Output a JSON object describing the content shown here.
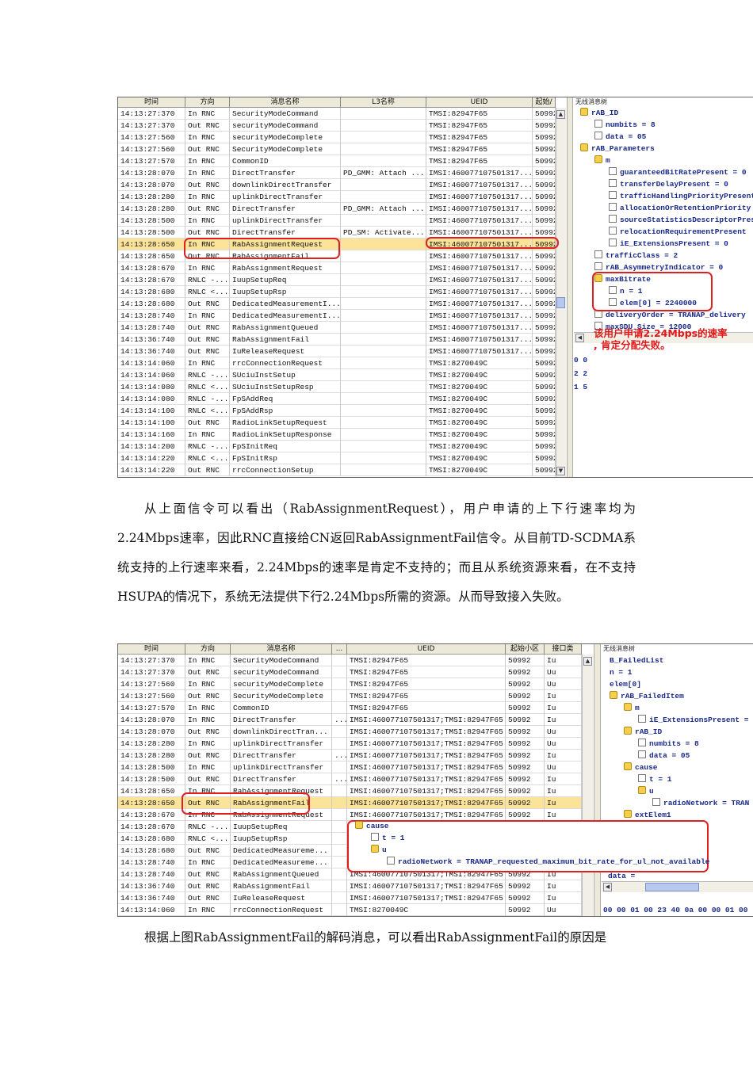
{
  "shot1": {
    "headers": [
      "时间",
      "方向",
      "消息名称",
      "L3名称",
      "UEID",
      "起始/"
    ],
    "rows": [
      [
        "14:13:27:370",
        "In RNC",
        "SecurityModeCommand",
        "",
        "TMSI:82947F65",
        "50992"
      ],
      [
        "14:13:27:370",
        "Out RNC",
        "securityModeCommand",
        "",
        "TMSI:82947F65",
        "50992"
      ],
      [
        "14:13:27:560",
        "In RNC",
        "securityModeComplete",
        "",
        "TMSI:82947F65",
        "50992"
      ],
      [
        "14:13:27:560",
        "Out RNC",
        "SecurityModeComplete",
        "",
        "TMSI:82947F65",
        "50992"
      ],
      [
        "14:13:27:570",
        "In RNC",
        "CommonID",
        "",
        "TMSI:82947F65",
        "50992"
      ],
      [
        "14:13:28:070",
        "In RNC",
        "DirectTransfer",
        "PD_GMM: Attach ...",
        "IMSI:460077107501317...",
        "50992"
      ],
      [
        "14:13:28:070",
        "Out RNC",
        "downlinkDirectTransfer",
        "",
        "IMSI:460077107501317...",
        "50992"
      ],
      [
        "14:13:28:280",
        "In RNC",
        "uplinkDirectTransfer",
        "",
        "IMSI:460077107501317...",
        "50992"
      ],
      [
        "14:13:28:280",
        "Out RNC",
        "DirectTransfer",
        "PD_GMM: Attach ...",
        "IMSI:460077107501317...",
        "50992"
      ],
      [
        "14:13:28:500",
        "In RNC",
        "uplinkDirectTransfer",
        "",
        "IMSI:460077107501317...",
        "50992"
      ],
      [
        "14:13:28:500",
        "Out RNC",
        "DirectTransfer",
        "PD_SM: Activate...",
        "IMSI:460077107501317...",
        "50992"
      ],
      [
        "14:13:28:650",
        "In RNC",
        "RabAssignmentRequest",
        "",
        "IMSI:460077107501317...",
        "50992"
      ],
      [
        "14:13:28:650",
        "Out RNC",
        "RabAssignmentFail",
        "",
        "IMSI:460077107501317...",
        "50992"
      ],
      [
        "14:13:28:670",
        "In RNC",
        "RabAssignmentRequest",
        "",
        "IMSI:460077107501317...",
        "50992"
      ],
      [
        "14:13:28:670",
        "RNLC -...",
        "IuupSetupReq",
        "",
        "IMSI:460077107501317...",
        "50992"
      ],
      [
        "14:13:28:680",
        "RNLC <...",
        "IuupSetupRsp",
        "",
        "IMSI:460077107501317...",
        "50992"
      ],
      [
        "14:13:28:680",
        "Out RNC",
        "DedicatedMeasurementI...",
        "",
        "IMSI:460077107501317...",
        "50992"
      ],
      [
        "14:13:28:740",
        "In RNC",
        "DedicatedMeasurementI...",
        "",
        "IMSI:460077107501317...",
        "50992"
      ],
      [
        "14:13:28:740",
        "Out RNC",
        "RabAssignmentQueued",
        "",
        "IMSI:460077107501317...",
        "50992"
      ],
      [
        "14:13:36:740",
        "Out RNC",
        "RabAssignmentFail",
        "",
        "IMSI:460077107501317...",
        "50992"
      ],
      [
        "14:13:36:740",
        "Out RNC",
        "IuReleaseRequest",
        "",
        "IMSI:460077107501317...",
        "50992"
      ],
      [
        "14:13:14:060",
        "In RNC",
        "rrcConnectionRequest",
        "",
        "TMSI:8270049C",
        "50992"
      ],
      [
        "14:13:14:060",
        "RNLC -...",
        "SUciuInstSetup",
        "",
        "TMSI:8270049C",
        "50992"
      ],
      [
        "14:13:14:080",
        "RNLC <...",
        "SUciuInstSetupResp",
        "",
        "TMSI:8270049C",
        "50992"
      ],
      [
        "14:13:14:080",
        "RNLC -...",
        "FpSAddReq",
        "",
        "TMSI:8270049C",
        "50992"
      ],
      [
        "14:13:14:100",
        "RNLC <...",
        "FpSAddRsp",
        "",
        "TMSI:8270049C",
        "50992"
      ],
      [
        "14:13:14:100",
        "Out RNC",
        "RadioLinkSetupRequest",
        "",
        "TMSI:8270049C",
        "50992"
      ],
      [
        "14:13:14:160",
        "In RNC",
        "RadioLinkSetupResponse",
        "",
        "TMSI:8270049C",
        "50992"
      ],
      [
        "14:13:14:200",
        "RNLC -...",
        "FpSInitReq",
        "",
        "TMSI:8270049C",
        "50992"
      ],
      [
        "14:13:14:220",
        "RNLC <...",
        "FpSInitRsp",
        "",
        "TMSI:8270049C",
        "50992"
      ],
      [
        "14:13:14:220",
        "Out RNC",
        "rrcConnectionSetup",
        "",
        "TMSI:8270049C",
        "50992"
      ]
    ],
    "selected_row": 11,
    "tree_title": "无线消息树",
    "tree": [
      [
        0,
        "folder",
        "rAB_ID"
      ],
      [
        1,
        "file",
        "numbits = 8"
      ],
      [
        1,
        "file",
        "data = 05"
      ],
      [
        0,
        "folder",
        "rAB_Parameters"
      ],
      [
        1,
        "folder",
        "m"
      ],
      [
        2,
        "file",
        "guaranteedBitRatePresent = 0"
      ],
      [
        2,
        "file",
        "transferDelayPresent = 0"
      ],
      [
        2,
        "file",
        "trafficHandlingPriorityPresent"
      ],
      [
        2,
        "file",
        "allocationOrRetentionPriority"
      ],
      [
        2,
        "file",
        "sourceStatisticsDescriptorPresent"
      ],
      [
        2,
        "file",
        "relocationRequirementPresent"
      ],
      [
        2,
        "file",
        "iE_ExtensionsPresent = 0"
      ],
      [
        1,
        "file",
        "trafficClass = 2"
      ],
      [
        1,
        "file",
        "rAB_AsymmetryIndicator = 0"
      ],
      [
        1,
        "folder",
        "maxBitrate"
      ],
      [
        2,
        "file",
        "n = 1"
      ],
      [
        2,
        "file",
        "elem[0] = 2240000"
      ],
      [
        1,
        "file",
        "deliveryOrder = TRANAP_delivery"
      ],
      [
        1,
        "file",
        "maxSDU_Size = 12000"
      ]
    ],
    "annotation": [
      "该用户申请2.24Mbps的速率",
      ", 肯定分配失败。"
    ],
    "hex_lines": [
      "0 0",
      "2 2",
      "1 5"
    ]
  },
  "paragraph1": "从上面信令可以看出（RabAssignmentRequest），用户申请的上下行速率均为2.24Mbps速率，因此RNC直接给CN返回RabAssignmentFail信令。从目前TD-SCDMA系统支持的上行速率来看，2.24Mbps的速率是肯定不支持的；而且从系统资源来看，在不支持HSUPA的情况下，系统无法提供下行2.24Mbps所需的资源。从而导致接入失败。",
  "shot2": {
    "headers": [
      "时间",
      "方向",
      "消息名称",
      "...",
      "UEID",
      "起始小区",
      "接口类"
    ],
    "rows": [
      [
        "14:13:27:370",
        "In RNC",
        "SecurityModeCommand",
        "",
        "TMSI:82947F65",
        "50992",
        "Iu"
      ],
      [
        "14:13:27:370",
        "Out RNC",
        "securityModeCommand",
        "",
        "TMSI:82947F65",
        "50992",
        "Uu"
      ],
      [
        "14:13:27:560",
        "In RNC",
        "securityModeComplete",
        "",
        "TMSI:82947F65",
        "50992",
        "Uu"
      ],
      [
        "14:13:27:560",
        "Out RNC",
        "SecurityModeComplete",
        "",
        "TMSI:82947F65",
        "50992",
        "Iu"
      ],
      [
        "14:13:27:570",
        "In RNC",
        "CommonID",
        "",
        "TMSI:82947F65",
        "50992",
        "Iu"
      ],
      [
        "14:13:28:070",
        "In RNC",
        "DirectTransfer",
        "...",
        "IMSI:460077107501317;TMSI:82947F65",
        "50992",
        "Iu"
      ],
      [
        "14:13:28:070",
        "Out RNC",
        "downlinkDirectTran...",
        "",
        "IMSI:460077107501317;TMSI:82947F65",
        "50992",
        "Uu"
      ],
      [
        "14:13:28:280",
        "In RNC",
        "uplinkDirectTransfer",
        "",
        "IMSI:460077107501317;TMSI:82947F65",
        "50992",
        "Uu"
      ],
      [
        "14:13:28:280",
        "Out RNC",
        "DirectTransfer",
        "...",
        "IMSI:460077107501317;TMSI:82947F65",
        "50992",
        "Iu"
      ],
      [
        "14:13:28:500",
        "In RNC",
        "uplinkDirectTransfer",
        "",
        "IMSI:460077107501317;TMSI:82947F65",
        "50992",
        "Uu"
      ],
      [
        "14:13:28:500",
        "Out RNC",
        "DirectTransfer",
        "...",
        "IMSI:460077107501317;TMSI:82947F65",
        "50992",
        "Iu"
      ],
      [
        "14:13:28:650",
        "In RNC",
        "RabAssignmentRequest",
        "",
        "IMSI:460077107501317;TMSI:82947F65",
        "50992",
        "Iu"
      ],
      [
        "14:13:28:650",
        "Out RNC",
        "RabAssignmentFail",
        "",
        "IMSI:460077107501317;TMSI:82947F65",
        "50992",
        "Iu"
      ],
      [
        "14:13:28:670",
        "In RNC",
        "RabAssignmentRequest",
        "",
        "IMSI:460077107501317;TMSI:82947F65",
        "50992",
        "Iu"
      ],
      [
        "14:13:28:670",
        "RNLC -...",
        "IuupSetupReq",
        "",
        "",
        "",
        ""
      ],
      [
        "14:13:28:680",
        "RNLC <...",
        "IuupSetupRsp",
        "",
        "",
        "",
        ""
      ],
      [
        "14:13:28:680",
        "Out RNC",
        "DedicatedMeasureme...",
        "",
        "",
        "",
        ""
      ],
      [
        "14:13:28:740",
        "In RNC",
        "DedicatedMeasureme...",
        "",
        "",
        "",
        ""
      ],
      [
        "14:13:28:740",
        "Out RNC",
        "RabAssignmentQueued",
        "",
        "IMSI:460077107501317;TMSI:82947F65",
        "50992",
        "Iu"
      ],
      [
        "14:13:36:740",
        "Out RNC",
        "RabAssignmentFail",
        "",
        "IMSI:460077107501317;TMSI:82947F65",
        "50992",
        "Iu"
      ],
      [
        "14:13:36:740",
        "Out RNC",
        "IuReleaseRequest",
        "",
        "IMSI:460077107501317;TMSI:82947F65",
        "50992",
        "Iu"
      ],
      [
        "14:13:14:060",
        "In RNC",
        "rrcConnectionRequest",
        "",
        "TMSI:8270049C",
        "50992",
        "Uu"
      ]
    ],
    "selected_row": 12,
    "tree_title": "无线消息树",
    "tree": [
      [
        0,
        "none",
        "B_FailedList"
      ],
      [
        0,
        "none",
        "n = 1"
      ],
      [
        0,
        "none",
        "elem[0]"
      ],
      [
        0,
        "folder",
        "rAB_FailedItem"
      ],
      [
        1,
        "folder",
        "m"
      ],
      [
        2,
        "file",
        "iE_ExtensionsPresent ="
      ],
      [
        1,
        "folder",
        "rAB_ID"
      ],
      [
        2,
        "file",
        "numbits = 8"
      ],
      [
        2,
        "file",
        "data = 05"
      ],
      [
        1,
        "folder",
        "cause"
      ],
      [
        2,
        "file",
        "t = 1"
      ],
      [
        2,
        "folder",
        "u"
      ],
      [
        3,
        "file",
        "radioNetwork = TRAN"
      ],
      [
        1,
        "folder",
        "extElem1"
      ]
    ],
    "popup": [
      [
        0,
        "folder",
        "cause"
      ],
      [
        1,
        "file",
        "t = 1"
      ],
      [
        1,
        "folder",
        "u"
      ],
      [
        2,
        "file",
        "radioNetwork = TRANAP_requested_maximum_bit_rate_for_ul_not_available"
      ]
    ],
    "data_label": "data =",
    "hex_line": "00 00 01 00 23 40 0a 00 00 01 00"
  },
  "paragraph2": "根据上图RabAssignmentFail的解码消息，可以看出RabAssignmentFail的原因是"
}
